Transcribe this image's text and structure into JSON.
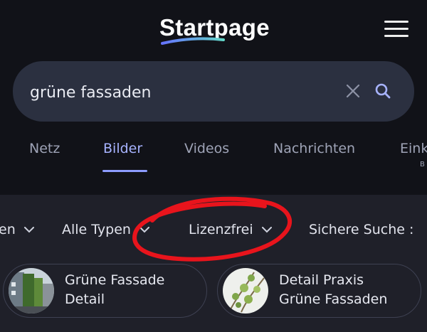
{
  "header": {
    "logo_text": "Startpage",
    "menu_icon": "hamburger-icon"
  },
  "search": {
    "query": "grüne fassaden",
    "clear_icon": "close-icon",
    "submit_icon": "search-icon"
  },
  "tabs": [
    {
      "label": "Netz",
      "active": false
    },
    {
      "label": "Bilder",
      "active": true
    },
    {
      "label": "Videos",
      "active": false
    },
    {
      "label": "Nachrichten",
      "active": false
    },
    {
      "label": "Eink",
      "active": false
    }
  ],
  "tab_overflow_sub": "B",
  "filters": [
    {
      "label": "en"
    },
    {
      "label": "Alle Typen"
    },
    {
      "label": "Lizenzfrei"
    },
    {
      "label": "Sichere Suche :"
    }
  ],
  "suggestions": [
    {
      "label_line1": "Grüne Fassade",
      "label_line2": "Detail"
    },
    {
      "label_line1": "Detail Praxis",
      "label_line2": "Grüne Fassaden"
    }
  ],
  "colors": {
    "accent": "#a7b3ff",
    "background": "#111218",
    "annotation": "#e8141c"
  }
}
